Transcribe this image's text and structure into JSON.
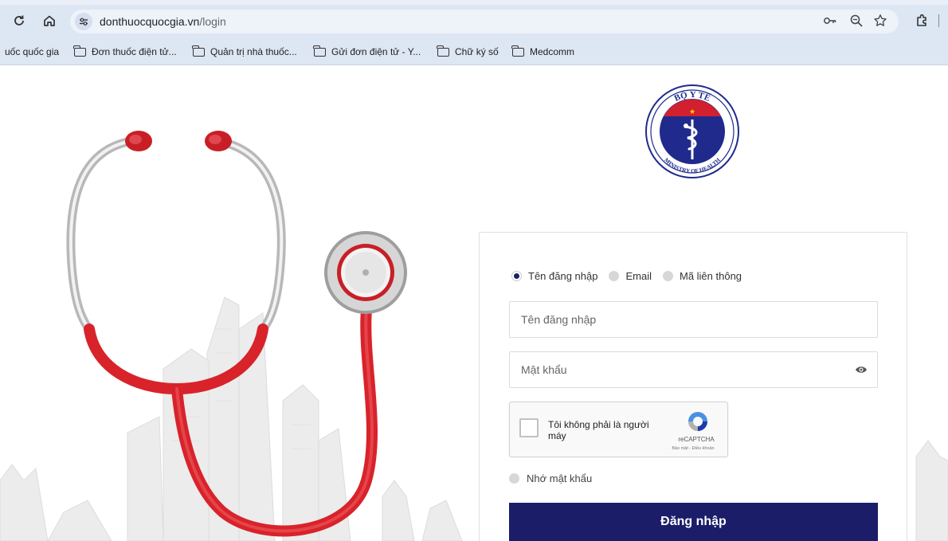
{
  "browser": {
    "url_host": "donthuocquocgia.vn",
    "url_path": "/login",
    "icons": {
      "reload": "reload-icon",
      "home": "home-icon",
      "site_settings": "site-settings-icon",
      "password_key": "key-icon",
      "zoom": "zoom-icon",
      "bookmark_star": "star-icon",
      "extensions": "extensions-icon"
    }
  },
  "bookmarks": [
    {
      "label": "uốc quốc gia",
      "folder": false
    },
    {
      "label": "Đơn thuốc điện tử...",
      "folder": true
    },
    {
      "label": "Quản trị nhà thuốc...",
      "folder": true
    },
    {
      "label": "Gửi đơn điện tử - Y...",
      "folder": true
    },
    {
      "label": "Chữ ký số",
      "folder": true
    },
    {
      "label": "Medcomm",
      "folder": true
    }
  ],
  "logo": {
    "top_text": "BỘ Y TẾ",
    "bottom_text": "MINISTRY OF HEALTH",
    "colors": {
      "blue": "#1f2a8c",
      "red": "#d2202f",
      "yellow": "#f5d60a"
    }
  },
  "login_form": {
    "login_type_options": [
      {
        "label": "Tên đăng nhập",
        "checked": true
      },
      {
        "label": "Email",
        "checked": false
      },
      {
        "label": "Mã liên thông",
        "checked": false
      }
    ],
    "username_placeholder": "Tên đăng nhập",
    "password_placeholder": "Mật khẩu",
    "captcha": {
      "label": "Tôi không phải là người máy",
      "brand": "reCAPTCHA",
      "terms": "Bảo mật - Điều khoản",
      "checked": false
    },
    "remember_label": "Nhớ mật khẩu",
    "submit_label": "Đăng nhập"
  },
  "colors": {
    "primary_button": "#1b1d69",
    "browser_chrome": "#dde6f3",
    "stethoscope_red": "#d8232a"
  }
}
